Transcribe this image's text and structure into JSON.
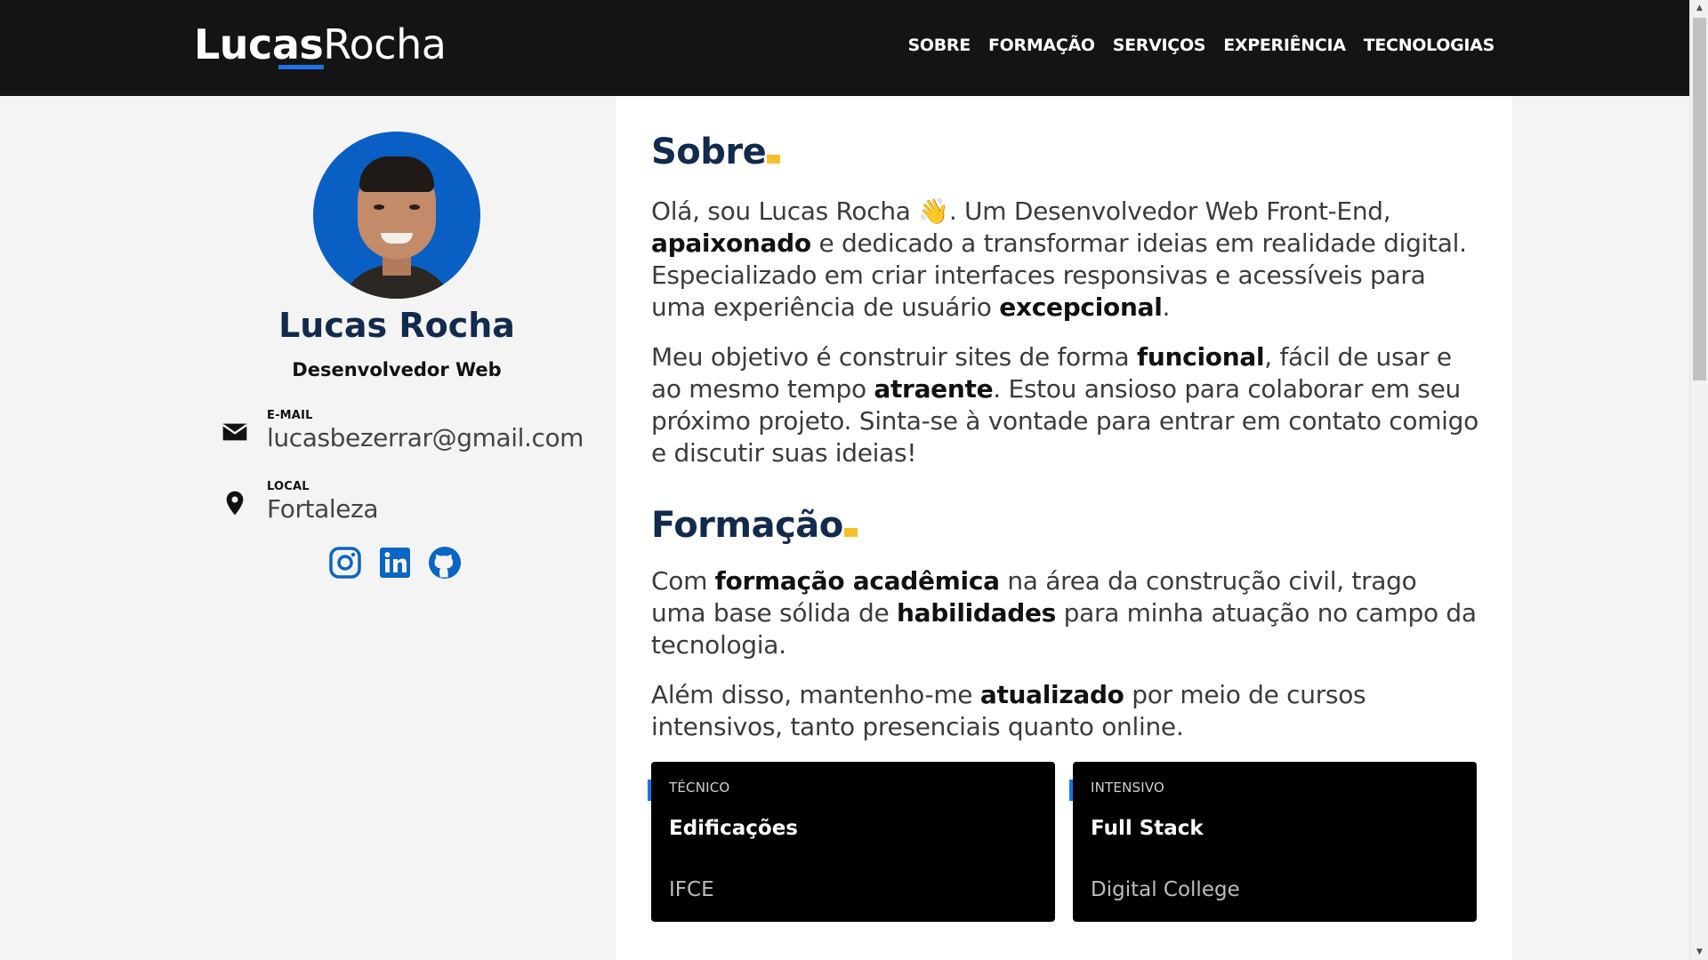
{
  "header": {
    "logo_first": "Lucas",
    "logo_last": "Rocha",
    "nav": [
      "SOBRE",
      "FORMAÇÃO",
      "SERVIÇOS",
      "EXPERIÊNCIA",
      "TECNOLOGIAS"
    ]
  },
  "profile": {
    "name": "Lucas Rocha",
    "role": "Desenvolvedor Web",
    "email_label": "E-MAIL",
    "email": "lucasbezerrar@gmail.com",
    "location_label": "LOCAL",
    "location": "Fortaleza",
    "socials": [
      "instagram-icon",
      "linkedin-icon",
      "github-icon"
    ]
  },
  "sobre": {
    "title": "Sobre",
    "p1": [
      {
        "t": "Olá, sou Lucas Rocha "
      },
      {
        "t": "👋",
        "emoji": true
      },
      {
        "t": ". Um Desenvolvedor Web Front-End, "
      },
      {
        "t": "apaixonado",
        "b": true
      },
      {
        "t": " e dedicado a transformar ideias em realidade digital. Especializado em criar interfaces responsivas e acessíveis para uma experiência de usuário "
      },
      {
        "t": "excepcional",
        "b": true
      },
      {
        "t": "."
      }
    ],
    "p2": [
      {
        "t": "Meu objetivo é construir sites de forma "
      },
      {
        "t": "funcional",
        "b": true
      },
      {
        "t": ", fácil de usar e ao mesmo tempo "
      },
      {
        "t": "atraente",
        "b": true
      },
      {
        "t": ". Estou ansioso para colaborar em seu próximo projeto. Sinta-se à vontade para entrar em contato comigo e discutir suas ideias!"
      }
    ]
  },
  "formacao": {
    "title": "Formação",
    "p1": [
      {
        "t": "Com "
      },
      {
        "t": "formação acadêmica",
        "b": true
      },
      {
        "t": " na área da construção civil, trago uma base sólida de "
      },
      {
        "t": "habilidades",
        "b": true
      },
      {
        "t": " para minha atuação no campo da tecnologia."
      }
    ],
    "p2": [
      {
        "t": "Além disso, mantenho-me "
      },
      {
        "t": "atualizado",
        "b": true
      },
      {
        "t": " por meio de cursos intensivos, tanto presenciais quanto online."
      }
    ],
    "cards": [
      {
        "type": "TÉCNICO",
        "title": "Edificações",
        "institution": "IFCE"
      },
      {
        "type": "INTENSIVO",
        "title": "Full Stack",
        "institution": "Digital College"
      }
    ]
  },
  "colors": {
    "header_bg": "#141414",
    "accent_blue": "#1a73e8",
    "accent_yellow": "#f7c02b",
    "title_navy": "#112a4d"
  }
}
